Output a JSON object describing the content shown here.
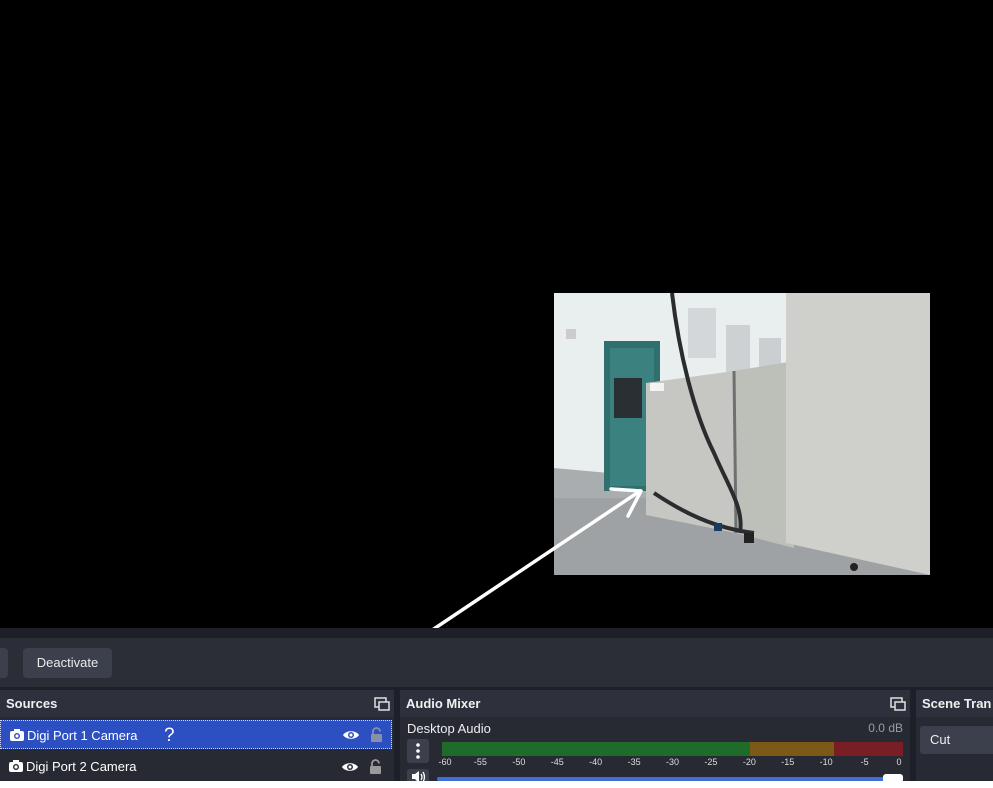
{
  "controls": {
    "deactivate_label": "Deactivate"
  },
  "sources": {
    "title": "Sources",
    "items": [
      {
        "label": "Digi Port 1 Camera",
        "selected": true,
        "status_glyph": "?"
      },
      {
        "label": "Digi Port 2 Camera",
        "selected": false
      }
    ]
  },
  "audio_mixer": {
    "title": "Audio Mixer",
    "channel_name": "Desktop Audio",
    "level": "0.0 dB",
    "volume_fraction": 1.0,
    "ticks": [
      "-60",
      "-55",
      "-50",
      "-45",
      "-40",
      "-35",
      "-30",
      "-25",
      "-20",
      "-15",
      "-10",
      "-5",
      "0"
    ]
  },
  "scene_transitions": {
    "title": "Scene Tran",
    "selected": "Cut"
  },
  "colors": {
    "selection_blue": "#2c4fc2",
    "meter_green": "#1f6b2a",
    "meter_yellow": "#7a5a16",
    "meter_red": "#7a1e26"
  }
}
